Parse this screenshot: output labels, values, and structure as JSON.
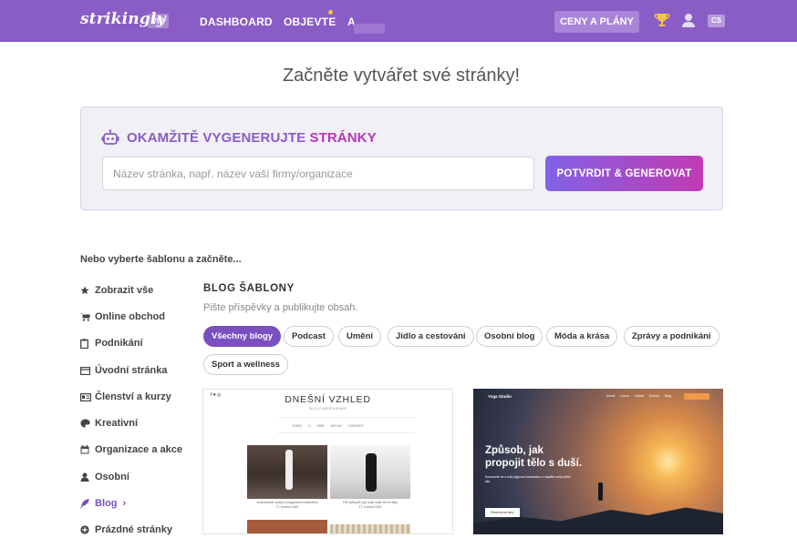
{
  "topbar": {
    "logo": "strikingly",
    "vip_badge": "VIP",
    "nav": [
      "DASHBOARD",
      "OBJEVTE",
      "A"
    ],
    "pricing_button": "CENY A PLÁNY",
    "language": "CS"
  },
  "page_title": "Začněte vytvářet své stránky!",
  "generator": {
    "title_part1": "OKAMŽITĚ VYGENERUJTE",
    "title_part2": "STRÁNKY",
    "input_placeholder": "Název stránka, např. název vaší firmy/organizace",
    "submit_button": "POTVRDIT & GENEROVAT"
  },
  "or_choose": "Nebo vyberte šablonu a začněte...",
  "sidebar": {
    "items": [
      {
        "label": "Zobrazit vše",
        "icon": "star-icon"
      },
      {
        "label": "Online obchod",
        "icon": "cart-icon"
      },
      {
        "label": "Podnikání",
        "icon": "clipboard-icon"
      },
      {
        "label": "Úvodní stránka",
        "icon": "browser-window-icon"
      },
      {
        "label": "Členství a kurzy",
        "icon": "id-card-icon"
      },
      {
        "label": "Kreativní",
        "icon": "palette-icon"
      },
      {
        "label": "Organizace a akce",
        "icon": "calendar-icon"
      },
      {
        "label": "Osobní",
        "icon": "person-icon"
      },
      {
        "label": "Blog",
        "icon": "feather-icon",
        "active": true
      },
      {
        "label": "Prázdné stránky",
        "icon": "plus-circle-icon"
      }
    ],
    "active_chevron": "›"
  },
  "blog_section": {
    "title": "BLOG ŠABLONY",
    "subtitle": "Pište příspěvky a publikujte obsah.",
    "filters": [
      "Všechny blogy",
      "Podcast",
      "Umění",
      "Jídlo a cestování",
      "Osobní blog",
      "Móda a krása",
      "Zprávy a podnikání",
      "Sport a wellness"
    ],
    "active_filter": 0
  },
  "cards": {
    "fashion": {
      "title": "DNEŠNÍ VZHLED",
      "social": "f  ♥  ◎",
      "tagline": "BLOG O MÓDĚ A KRÁSE",
      "nav": "DOMŮ  O MNĚ  ARCHIV  KONTAKT",
      "caption1": "Jednoduché outfity s elegantním nádechem",
      "date1": "17. května 2022",
      "caption2": "Pět způsobů, jak nosit malé černé šaty",
      "date2": "17. května 2022"
    },
    "yoga": {
      "brand": "Yoga Studio",
      "nav": "Domů Lekce Lektoři Rozvrh Blog",
      "headline_line1": "Způsob, jak",
      "headline_line2": "propojit tělo s duší.",
      "text": "Seznamte se s naší jógovou komunitou a najděte svůj vnitřní klid.",
      "button": "Rezervovat lekci"
    }
  },
  "colors": {
    "topbar": "#8a5cc6",
    "accent_purple": "#7a4fc0",
    "accent_magenta": "#b536b8"
  }
}
